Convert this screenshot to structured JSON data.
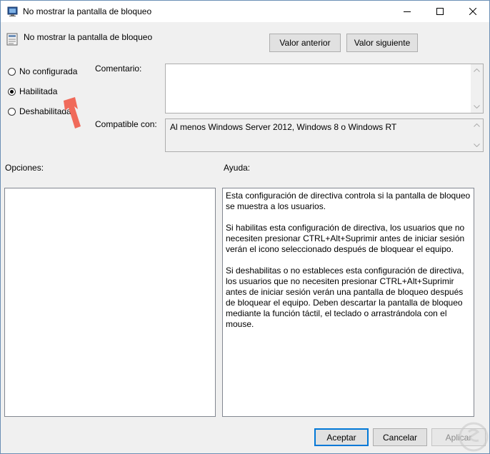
{
  "window": {
    "title": "No mostrar la pantalla de bloqueo",
    "controls": [
      "minimize",
      "maximize",
      "close"
    ]
  },
  "header": {
    "setting_name": "No mostrar la pantalla de bloqueo",
    "prev_button": "Valor anterior",
    "next_button": "Valor siguiente"
  },
  "state_options": [
    {
      "label": "No configurada",
      "checked": false
    },
    {
      "label": "Habilitada",
      "checked": true
    },
    {
      "label": "Deshabilitada",
      "checked": false
    }
  ],
  "comment": {
    "label": "Comentario:",
    "value": ""
  },
  "compatible": {
    "label": "Compatible con:",
    "value": "Al menos Windows Server 2012, Windows 8 o Windows RT"
  },
  "options_label": "Opciones:",
  "help_label": "Ayuda:",
  "help_paragraphs": [
    "Esta configuración de directiva controla si la pantalla de bloqueo se muestra a los usuarios.",
    "Si habilitas esta configuración de directiva, los usuarios que no necesiten presionar CTRL+Alt+Suprimir antes de iniciar sesión verán el icono seleccionado después de bloquear el equipo.",
    "Si deshabilitas o no estableces esta configuración de directiva, los usuarios que no necesiten presionar CTRL+Alt+Suprimir antes de iniciar sesión verán una pantalla de bloqueo después de bloquear el equipo. Deben descartar la pantalla de bloqueo mediante la función táctil, el teclado o arrastrándola con el mouse."
  ],
  "footer": {
    "ok": "Aceptar",
    "cancel": "Cancelar",
    "apply": "Aplicar"
  },
  "colors": {
    "accent": "#0078d7",
    "annotation_arrow": "#f06a5a"
  }
}
